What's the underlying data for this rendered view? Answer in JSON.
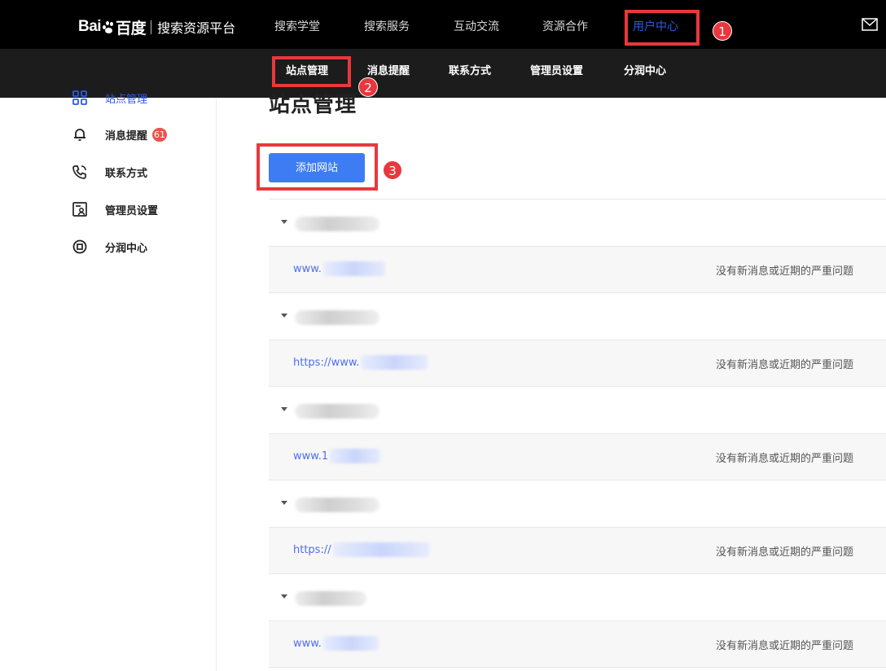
{
  "header": {
    "logo_text": "Bai",
    "logo_text2": "百度",
    "logo_sub": "搜索资源平台",
    "nav": [
      "搜索学堂",
      "搜索服务",
      "互动交流",
      "资源合作",
      "用户中心"
    ],
    "active_nav": "用户中心",
    "mail_icon": "mail-icon"
  },
  "subnav": {
    "items": [
      "站点管理",
      "消息提醒",
      "联系方式",
      "管理员设置",
      "分润中心"
    ],
    "active": "站点管理"
  },
  "sidebar": {
    "active_item": "站点管理",
    "items": [
      {
        "label": "消息提醒",
        "icon": "bell-icon",
        "badge": "61"
      },
      {
        "label": "联系方式",
        "icon": "phone-icon"
      },
      {
        "label": "管理员设置",
        "icon": "admin-icon"
      },
      {
        "label": "分润中心",
        "icon": "coin-icon"
      }
    ]
  },
  "main": {
    "title": "站点管理",
    "add_button": "添加网站",
    "sites": [
      {
        "url": "www.",
        "status": "没有新消息或近期的严重问题"
      },
      {
        "url": "https://www.",
        "status": "没有新消息或近期的严重问题"
      },
      {
        "url": "www.1",
        "status": "没有新消息或近期的严重问题"
      },
      {
        "url": "https://",
        "status": "没有新消息或近期的严重问题"
      },
      {
        "url": "www.",
        "status": "没有新消息或近期的严重问题"
      }
    ]
  },
  "annotations": {
    "markers": [
      "1",
      "2",
      "3"
    ],
    "color": "#e8383d"
  },
  "colors": {
    "accent": "#2b5be5",
    "button": "#3d7cf3",
    "link": "#4e6ef2",
    "badge": "#f0514c"
  }
}
